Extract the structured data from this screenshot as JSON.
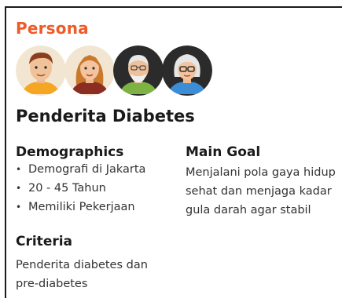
{
  "persona": {
    "label": "Persona",
    "title": "Penderita Diabetes",
    "avatars": [
      "young-man-avatar",
      "young-woman-avatar",
      "old-man-avatar",
      "old-woman-avatar"
    ]
  },
  "demographics": {
    "heading": "Demographics",
    "items": [
      "Demografi di Jakarta",
      "20 - 45 Tahun",
      "Memiliki Pekerjaan"
    ]
  },
  "main_goal": {
    "heading": "Main Goal",
    "lines": [
      "Menjalani pola gaya hidup",
      "sehat dan menjaga kadar",
      "gula darah agar stabil"
    ]
  },
  "criteria": {
    "heading": "Criteria",
    "lines": [
      "Penderita diabetes dan",
      "pre-diabetes"
    ]
  },
  "colors": {
    "accent": "#f05a28",
    "text": "#1a1a1a"
  }
}
